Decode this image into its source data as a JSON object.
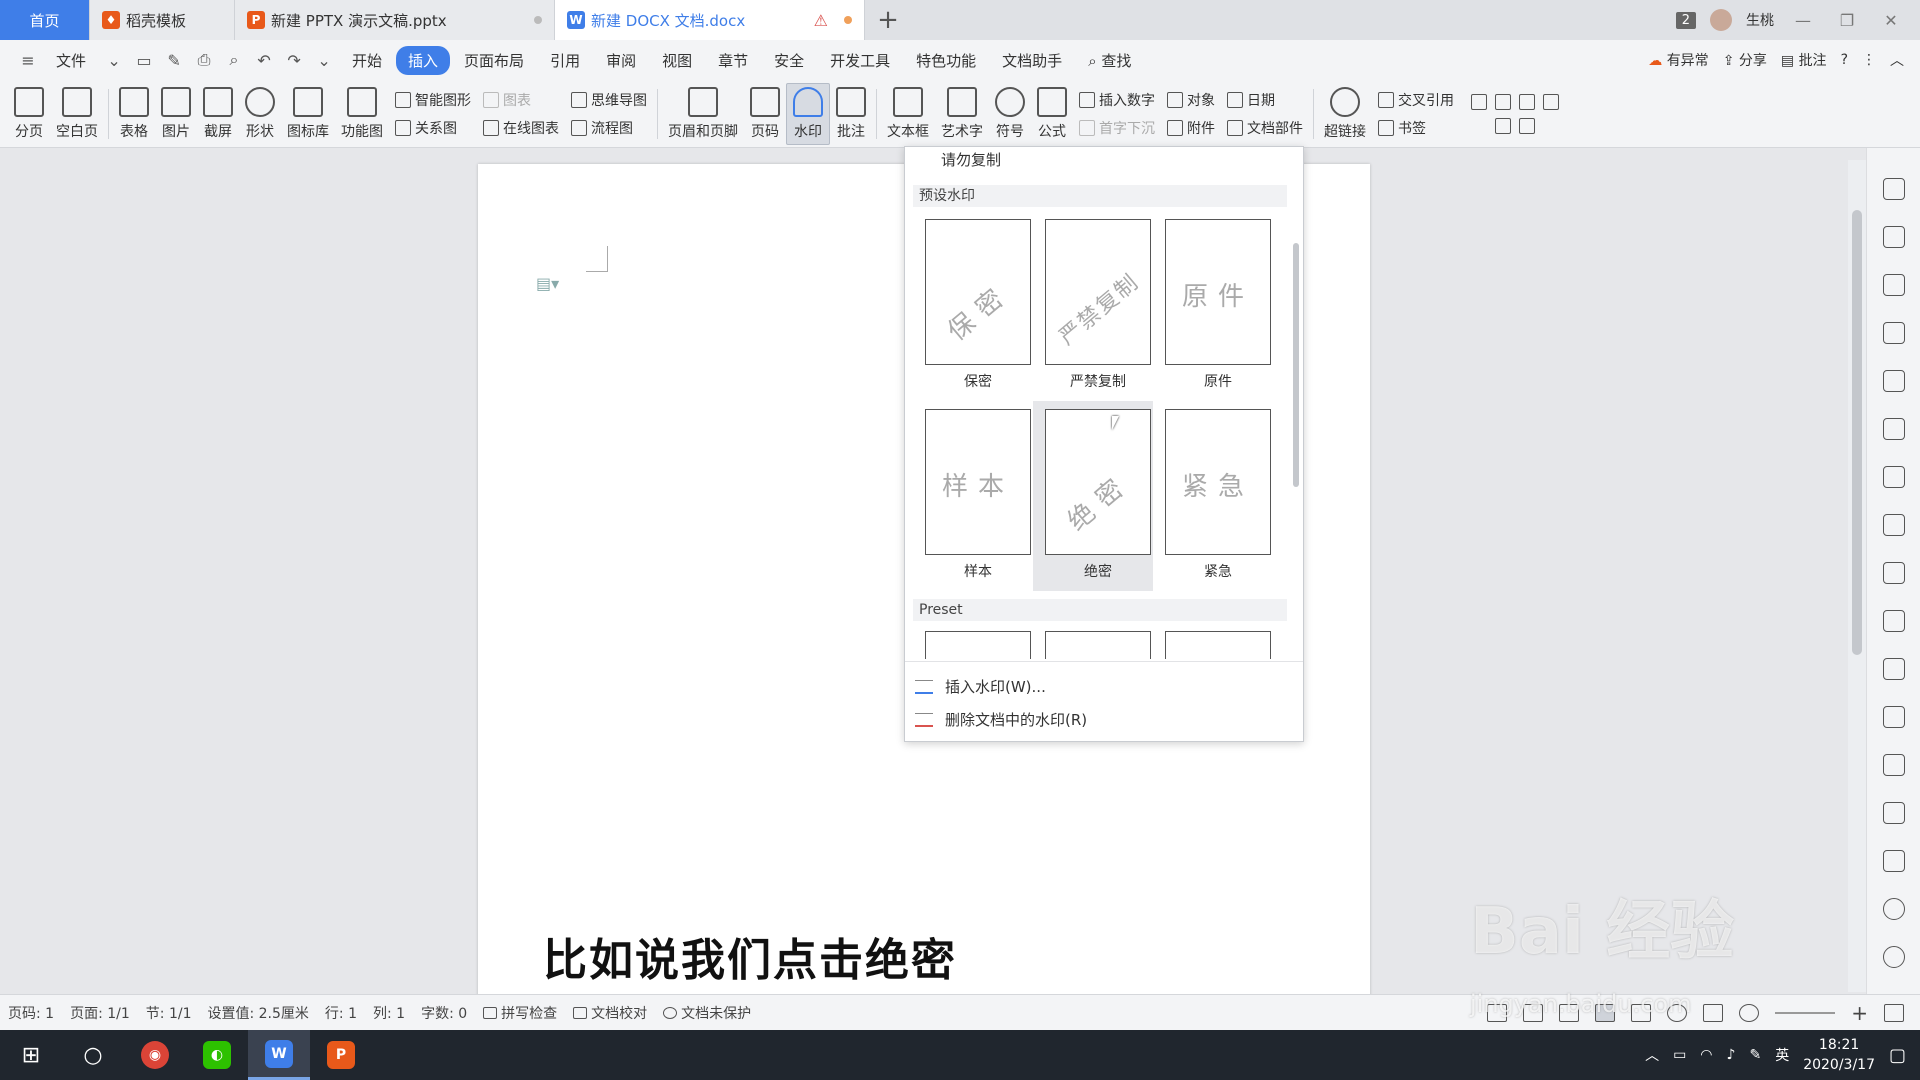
{
  "tabs": {
    "home": "首页",
    "items": [
      {
        "label": "稻壳模板",
        "icon_color": "#e8591a"
      },
      {
        "label": "新建 PPTX 演示文稿.pptx",
        "icon_color": "#e8591a"
      },
      {
        "label": "新建 DOCX 文档.docx",
        "icon_color": "#3f7ee8",
        "warning": "⚠"
      }
    ],
    "new_tab": "+",
    "badge": "2",
    "user": "生桃"
  },
  "menu": {
    "file": "文件",
    "items": [
      "开始",
      "插入",
      "页面布局",
      "引用",
      "审阅",
      "视图",
      "章节",
      "安全",
      "开发工具",
      "特色功能",
      "文档助手"
    ],
    "active": "插入",
    "search": "查找",
    "right": {
      "sync": "有异常",
      "share": "分享",
      "comment": "批注"
    }
  },
  "ribbon": {
    "page_break": "分页",
    "blank_page": "空白页",
    "table": "表格",
    "picture": "图片",
    "screenshot": "截屏",
    "shape": "形状",
    "icon_lib": "图标库",
    "func_chart": "功能图",
    "smart_shape": "智能图形",
    "chart": "图表",
    "relation": "关系图",
    "online_chart": "在线图表",
    "mindmap": "思维导图",
    "flowchart": "流程图",
    "header_footer": "页眉和页脚",
    "page_num": "页码",
    "watermark": "水印",
    "comment": "批注",
    "textbox": "文本框",
    "wordart": "艺术字",
    "symbol": "符号",
    "formula": "公式",
    "insert_number": "插入数字",
    "dropcap": "首字下沉",
    "object": "对象",
    "attachment": "附件",
    "date": "日期",
    "doc_part": "文档部件",
    "hyperlink": "超链接",
    "cross_ref": "交叉引用",
    "bookmark": "书签"
  },
  "dropdown": {
    "top_item": "请勿复制",
    "section_preset_cn": "预设水印",
    "watermarks": [
      {
        "text": "保密",
        "label": "保密",
        "diag": true
      },
      {
        "text": "严禁复制",
        "label": "严禁复制",
        "diag": true
      },
      {
        "text": "原件",
        "label": "原件",
        "diag": false
      },
      {
        "text": "样本",
        "label": "样本",
        "diag": false
      },
      {
        "text": "绝密",
        "label": "绝密",
        "diag": true
      },
      {
        "text": "紧急",
        "label": "紧急",
        "diag": false
      }
    ],
    "section_preset_en": "Preset",
    "insert": "插入水印(W)...",
    "delete": "删除文档中的水印(R)"
  },
  "document": {
    "caption": "比如说我们点击绝密"
  },
  "status": {
    "page": "页码: 1",
    "pages": "页面: 1/1",
    "section": "节: 1/1",
    "setting": "设置值: 2.5厘米",
    "row": "行: 1",
    "col": "列: 1",
    "words": "字数: 0",
    "spell": "拼写检查",
    "proof": "文档校对",
    "protect": "文档未保护"
  },
  "taskbar": {
    "ime": "英",
    "time": "18:21",
    "date": "2020/3/17"
  },
  "overlay": {
    "brand": "Bai 经验",
    "url": "jingyan.baidu.com"
  }
}
